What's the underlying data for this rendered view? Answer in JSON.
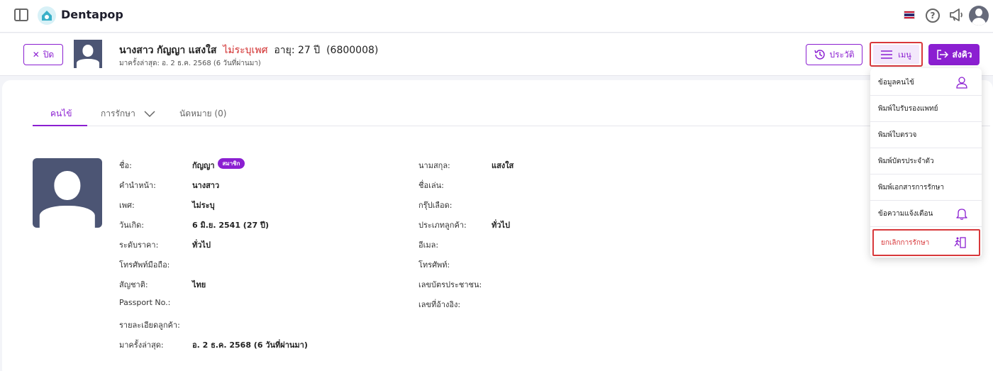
{
  "app": {
    "brand": "Dentapop"
  },
  "patient": {
    "close_label": "ปิด",
    "title": "นางสาว",
    "first_name": "กัญญา",
    "last_name": "แสงใส",
    "gender_text": "ไม่ระบุเพศ",
    "age_text": "อายุ: 27 ปี",
    "code_text": "(6800008)",
    "last_visit_text": "มาครั้งล่าสุด: อ. 2 ธ.ค. 2568 (6 วันที่ผ่านมา)"
  },
  "actions": {
    "history_label": "ประวัติ",
    "menu_label": "เมนู",
    "queue_label": "ส่งคิว"
  },
  "tabs": [
    {
      "label": "คนไข้"
    },
    {
      "label": "การรักษา"
    },
    {
      "label": "นัดหมาย (0)"
    }
  ],
  "details": {
    "left": [
      {
        "label": "ชื่อ:",
        "value": "กัญญา"
      },
      {
        "label": "คำนำหน้า:",
        "value": "นางสาว"
      },
      {
        "label": "เพศ:",
        "value": "ไม่ระบุ"
      },
      {
        "label": "วันเกิด:",
        "value": "6 มิ.ย. 2541 (27 ปี)"
      },
      {
        "label": "ระดับราคา:",
        "value": "ทั่วไป"
      },
      {
        "label": "โทรศัพท์มือถือ:",
        "value": ""
      },
      {
        "label": "สัญชาติ:",
        "value": "ไทย"
      },
      {
        "label": "Passport No.:",
        "value": ""
      },
      {
        "label": "รายละเอียดลูกค้า:",
        "value": ""
      },
      {
        "label": "มาครั้งล่าสุด:",
        "value": "อ. 2 ธ.ค. 2568 (6 วันที่ผ่านมา)"
      }
    ],
    "right": [
      {
        "label": "นามสกุล:",
        "value": "แสงใส"
      },
      {
        "label": "ชื่อเล่น:",
        "value": ""
      },
      {
        "label": "กรุ๊ปเลือด:",
        "value": ""
      },
      {
        "label": "ประเภทลูกค้า:",
        "value": "ทั่วไป"
      },
      {
        "label": "อีเมล:",
        "value": ""
      },
      {
        "label": "โทรศัพท์:",
        "value": ""
      },
      {
        "label": "เลขบัตรประชาชน:",
        "value": ""
      },
      {
        "label": "เลขที่อ้างอิง:",
        "value": ""
      }
    ],
    "member_badge": "สมาชิก"
  },
  "menu_dropdown": {
    "items": [
      {
        "label": "ข้อมูลคนไข้",
        "icon": "user-icon"
      },
      {
        "label": "พิมพ์ใบรับรองแพทย์",
        "icon": ""
      },
      {
        "label": "พิมพ์ใบตรวจ",
        "icon": ""
      },
      {
        "label": "พิมพ์บัตรประจำตัว",
        "icon": ""
      },
      {
        "label": "พิมพ์เอกสารการรักษา",
        "icon": ""
      },
      {
        "label": "ข้อความแจ้งเตือน",
        "icon": "bell-icon"
      },
      {
        "label": "ยกเลิกการรักษา",
        "icon": "exit-icon"
      }
    ]
  },
  "colors": {
    "accent": "#8b1fd1",
    "danger": "#d8383b",
    "avatar_bg": "#4c5574"
  }
}
